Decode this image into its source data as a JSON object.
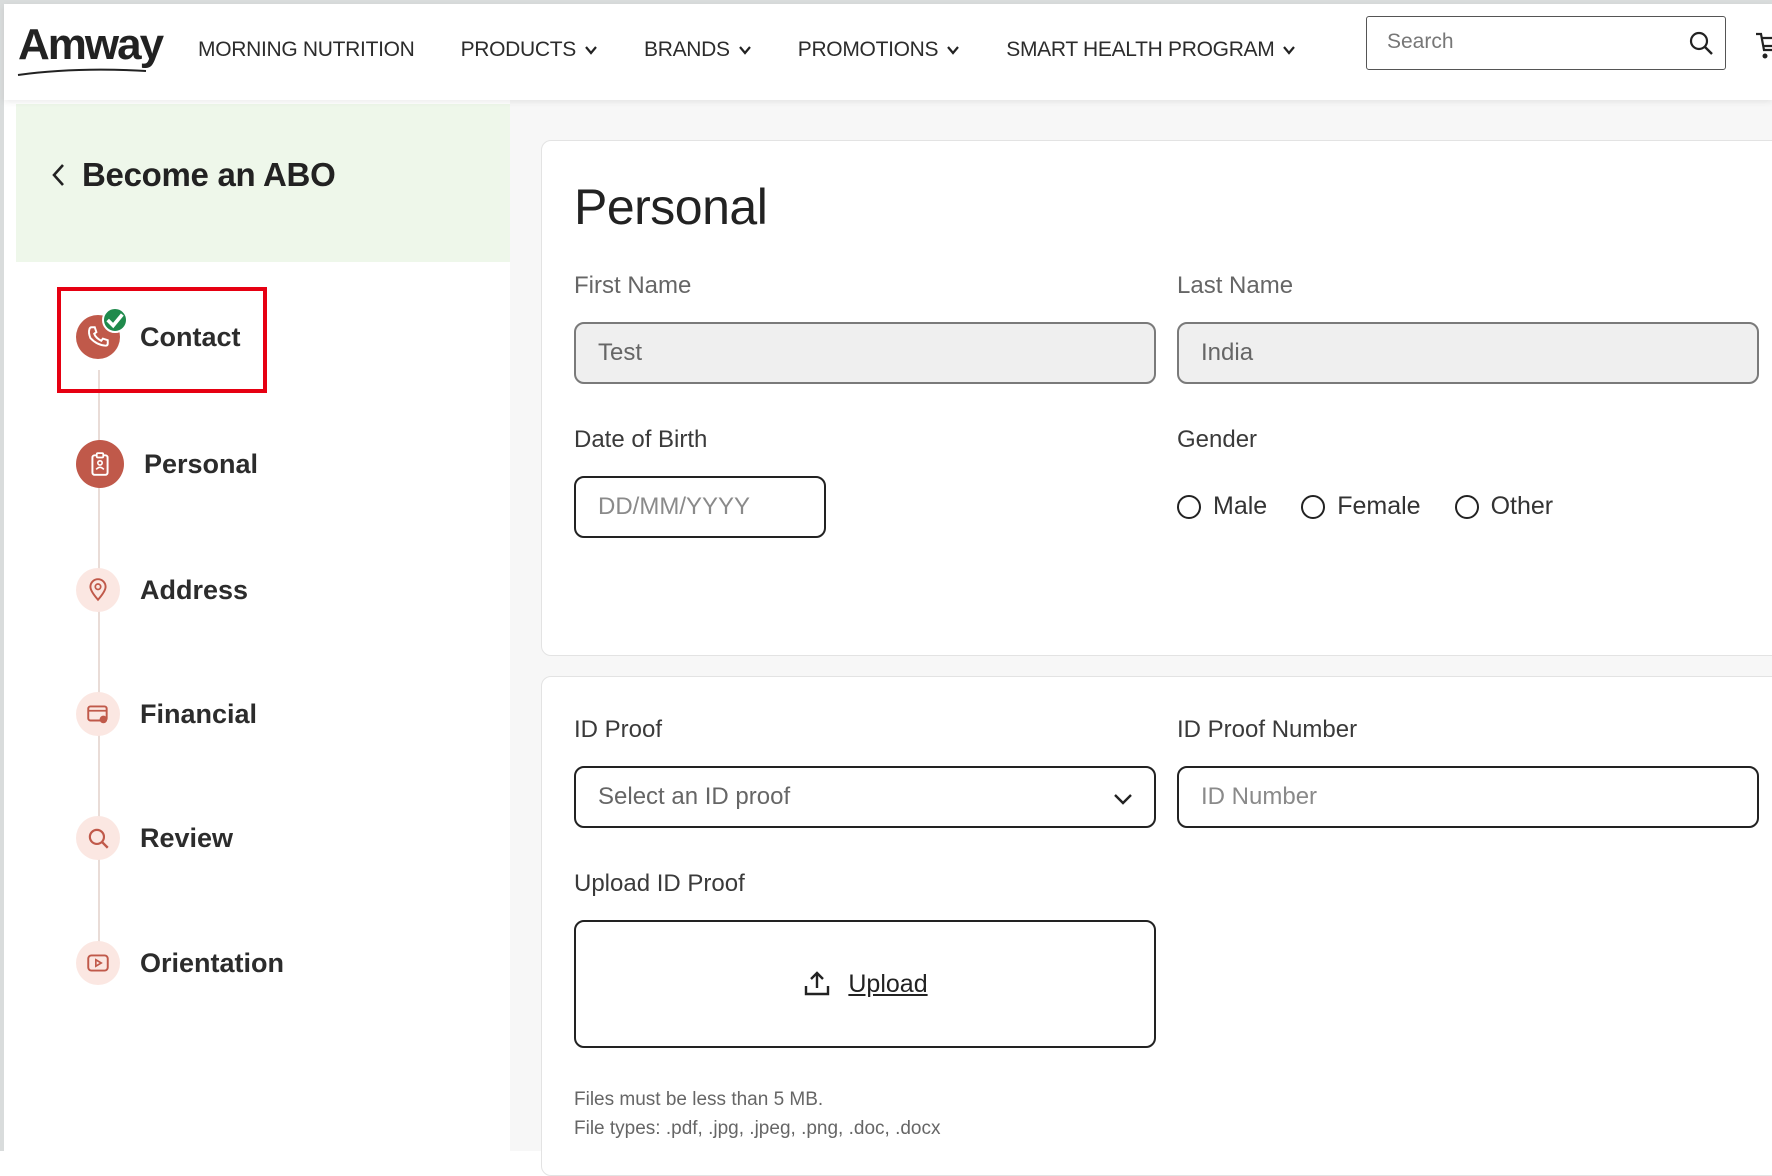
{
  "header": {
    "logo": "Amway",
    "nav": [
      {
        "label": "MORNING NUTRITION",
        "dropdown": false
      },
      {
        "label": "PRODUCTS",
        "dropdown": true
      },
      {
        "label": "BRANDS",
        "dropdown": true
      },
      {
        "label": "PROMOTIONS",
        "dropdown": true
      },
      {
        "label": "SMART HEALTH PROGRAM",
        "dropdown": true
      }
    ],
    "search_placeholder": "Search"
  },
  "sidebar": {
    "back_label": "Become an ABO",
    "steps": [
      {
        "label": "Contact",
        "icon": "phone-icon",
        "completed": true
      },
      {
        "label": "Personal",
        "icon": "clipboard-icon",
        "completed": false
      },
      {
        "label": "Address",
        "icon": "map-pin-icon",
        "completed": false
      },
      {
        "label": "Financial",
        "icon": "wallet-icon",
        "completed": false
      },
      {
        "label": "Review",
        "icon": "magnifier-icon",
        "completed": false
      },
      {
        "label": "Orientation",
        "icon": "play-icon",
        "completed": false
      }
    ]
  },
  "personal": {
    "title": "Personal",
    "first_name_label": "First Name",
    "first_name_value": "Test",
    "last_name_label": "Last Name",
    "last_name_value": "India",
    "dob_label": "Date of Birth",
    "dob_placeholder": "DD/MM/YYYY",
    "gender_label": "Gender",
    "gender_options": [
      "Male",
      "Female",
      "Other"
    ]
  },
  "id_proof": {
    "label": "ID Proof",
    "select_placeholder": "Select an ID proof",
    "number_label": "ID Proof Number",
    "number_placeholder": "ID Number",
    "upload_label": "Upload ID Proof",
    "upload_button": "Upload",
    "note_size": "Files must be less than 5 MB.",
    "note_types": "File types: .pdf, .jpg, .jpeg, .png, .doc, .docx"
  },
  "colors": {
    "accent": "#c0594a",
    "sidebar_bg": "#eef7ea",
    "highlight": "#e60012",
    "check": "#1f8a4c"
  }
}
